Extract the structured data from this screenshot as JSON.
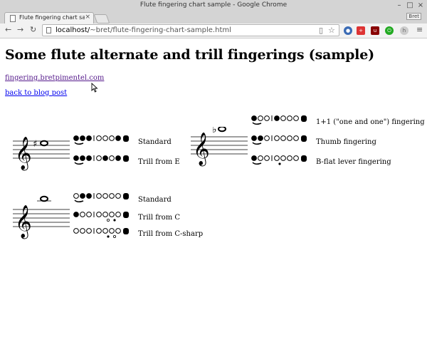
{
  "window": {
    "title": "Flute fingering chart sample - Google Chrome"
  },
  "tab": {
    "title": "Flute fingering chart sam",
    "close": "×"
  },
  "profile": {
    "label": "Bret"
  },
  "nav": {
    "back": "←",
    "forward": "→",
    "reload": "↻",
    "menu": "≡"
  },
  "url": {
    "prefix": "localhost/",
    "path": "~bret/flute-fingering-chart-sample.html"
  },
  "page": {
    "heading": "Some flute alternate and trill fingerings (sample)",
    "link_site": "fingering.bretpimentel.com",
    "link_back": "back to blog post"
  },
  "groups": [
    {
      "note": "F-sharp",
      "fingerings": [
        {
          "label": "Standard"
        },
        {
          "label": "Trill from E"
        }
      ]
    },
    {
      "note": "B-flat",
      "fingerings": [
        {
          "label": "1+1 (\"one and one\") fingering"
        },
        {
          "label": "Thumb fingering"
        },
        {
          "label": "B-flat lever fingering"
        }
      ]
    },
    {
      "note": "high D",
      "fingerings": [
        {
          "label": "Standard"
        },
        {
          "label": "Trill from C"
        },
        {
          "label": "Trill from C-sharp"
        }
      ]
    }
  ]
}
